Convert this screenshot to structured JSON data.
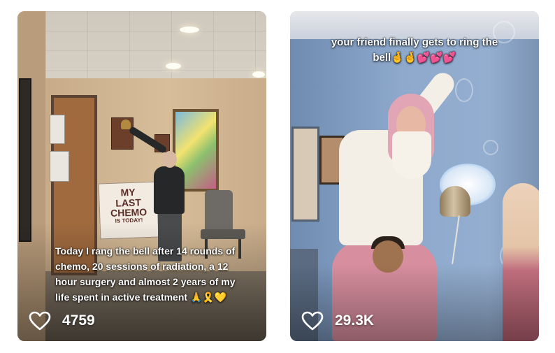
{
  "feed": {
    "posts": [
      {
        "caption": "Today I rang the bell after 14 rounds of chemo, 20 sessions of radiation, a 12 hour surgery and almost 2 years of my life spent in active treatment 🙏🎗️💛",
        "likes": "4759",
        "like_icon": "heart-outline-icon",
        "scene_sign": {
          "line1": "MY",
          "line2": "LAST",
          "line3": "CHEMO",
          "line4": "IS TODAY!"
        }
      },
      {
        "caption": "your friend finally gets to ring the bell🤞🤞💕💕💕",
        "likes": "29.3K",
        "like_icon": "heart-outline-icon"
      }
    ]
  },
  "colors": {
    "overlay_text": "#ffffff",
    "background": "#ffffff"
  }
}
